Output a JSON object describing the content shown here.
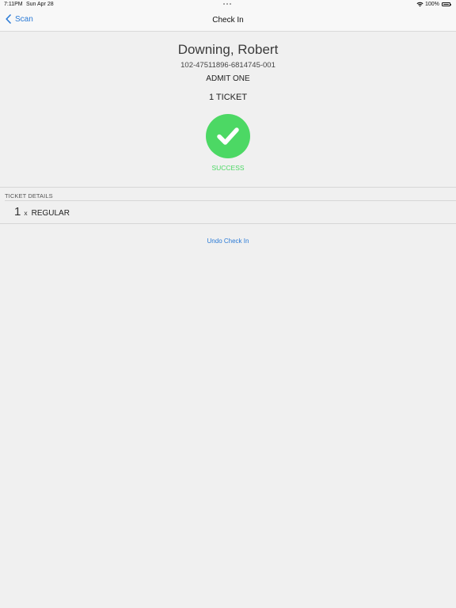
{
  "status_bar": {
    "time": "7:11PM",
    "date": "Sun Apr 28",
    "battery_percent": "100%",
    "wifi_icon": "wifi-icon",
    "battery_icon": "battery-icon"
  },
  "nav": {
    "back_label": "Scan",
    "back_icon": "chevron-left-icon",
    "title": "Check In"
  },
  "attendee": {
    "name": "Downing, Robert",
    "ticket_id": "102-47511896-6814745-001",
    "admission": "ADMIT ONE",
    "ticket_count": "1 TICKET"
  },
  "result": {
    "icon": "checkmark-icon",
    "label": "SUCCESS",
    "color": "#4cd864"
  },
  "ticket_details": {
    "header": "TICKET DETAILS",
    "items": [
      {
        "quantity": "1",
        "multiplier": "x",
        "type": "REGULAR"
      }
    ]
  },
  "actions": {
    "undo_label": "Undo Check In"
  },
  "colors": {
    "accent": "#2a7ad6",
    "success": "#4cd864",
    "background": "#f0f0f0"
  }
}
